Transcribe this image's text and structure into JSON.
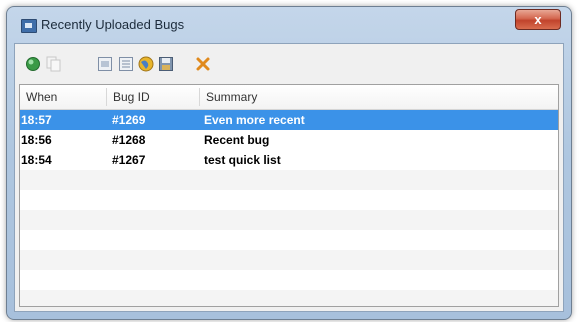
{
  "window": {
    "title": "Recently Uploaded Bugs",
    "close_label": "x"
  },
  "toolbar": {
    "buttons": [
      {
        "name": "open-bug-icon",
        "color": "#3a9a46"
      },
      {
        "name": "copy-icon",
        "color": "#c8c8c8"
      },
      {
        "name": "view-details-icon",
        "color": "#7f8fa6"
      },
      {
        "name": "view-list-icon",
        "color": "#7f8fa6"
      },
      {
        "name": "globe-icon",
        "color": "#d4a020"
      },
      {
        "name": "save-icon",
        "color": "#5a6f8a"
      },
      {
        "name": "delete-icon",
        "color": "#e08a1e"
      }
    ]
  },
  "list": {
    "columns": [
      "When",
      "Bug ID",
      "Summary"
    ],
    "rows": [
      {
        "when": "18:57",
        "bug_id": "#1269",
        "summary": "Even more recent",
        "selected": true
      },
      {
        "when": "18:56",
        "bug_id": "#1268",
        "summary": "Recent bug",
        "selected": false
      },
      {
        "when": "18:54",
        "bug_id": "#1267",
        "summary": "test quick list",
        "selected": false
      }
    ],
    "empty_row_count": 7
  }
}
